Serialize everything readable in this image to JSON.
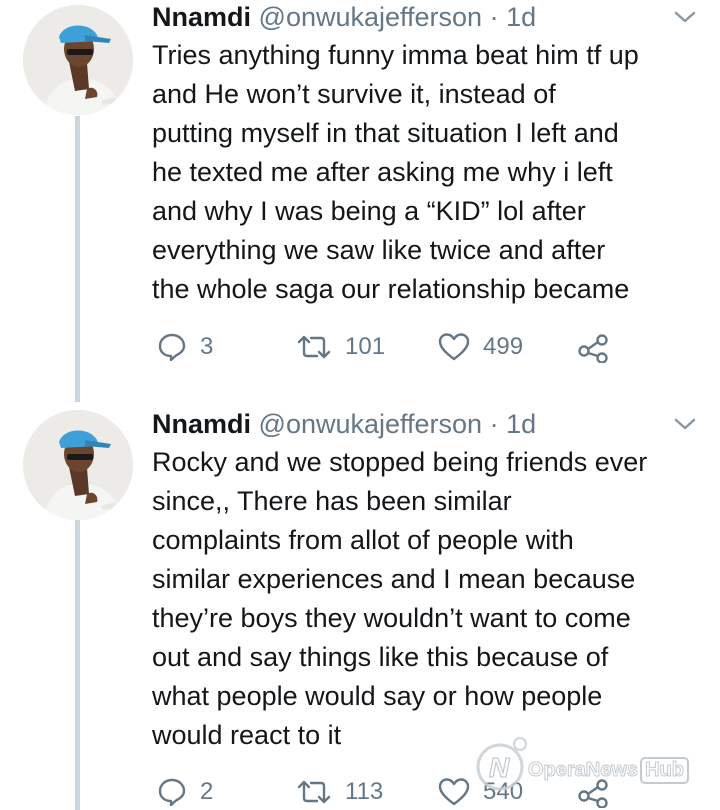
{
  "tweets": [
    {
      "author": {
        "name": "Nnamdi",
        "handle": "@onwukajefferson",
        "separator": "·",
        "time": "1d"
      },
      "lines": [
        "Tries anything funny imma beat him tf up",
        "and He won’t survive it, instead of",
        "putting myself in that situation I left and",
        "he texted me after asking me why i left",
        "and why I was being a “KID” lol after",
        "everything we saw like twice and after",
        "the whole saga our relationship became"
      ],
      "actions": {
        "replies": "3",
        "retweets": "101",
        "likes": "499"
      }
    },
    {
      "author": {
        "name": "Nnamdi",
        "handle": "@onwukajefferson",
        "separator": "·",
        "time": "1d"
      },
      "lines": [
        "Rocky and we stopped being friends ever",
        "since,, There has been similar",
        "complaints from allot of people with",
        "similar experiences and I mean because",
        "they’re boys they wouldn’t want to come",
        "out and say things like this because of",
        "what people would say or how people",
        "would react to it"
      ],
      "actions": {
        "replies": "2",
        "retweets": "113",
        "likes": "540"
      }
    }
  ],
  "watermark": {
    "brand": "OperaNews",
    "suffix": "Hub"
  },
  "icons": {
    "reply": "reply-icon",
    "retweet": "retweet-icon",
    "like": "heart-icon",
    "share": "share-icon",
    "menu": "chevron-down-icon"
  },
  "colors": {
    "text": "#14171a",
    "secondary": "#657786",
    "thread_line": "#ccd6dd",
    "cap_blue": "#3fa0d8"
  }
}
